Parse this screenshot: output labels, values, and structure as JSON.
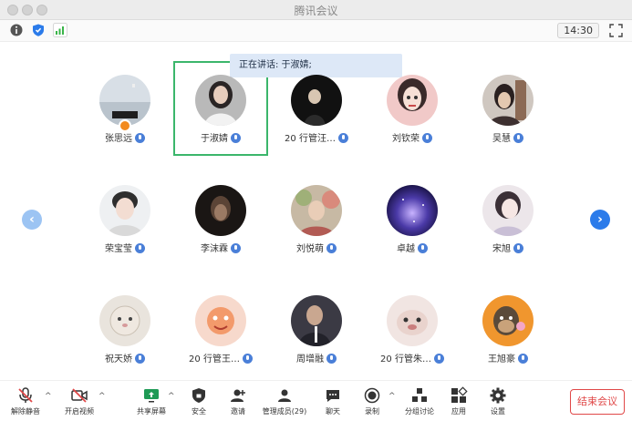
{
  "window": {
    "title": "腾讯会议"
  },
  "infobar": {
    "time": "14:30"
  },
  "speaking": {
    "text": "正在讲话: 于淑婧;"
  },
  "participants": [
    {
      "name": "张思远",
      "host": true
    },
    {
      "name": "于淑婧",
      "active": true
    },
    {
      "name": "20 行管汪…"
    },
    {
      "name": "刘钦荣"
    },
    {
      "name": "吴慧"
    },
    {
      "name": "荣宝莹"
    },
    {
      "name": "李沫霖"
    },
    {
      "name": "刘悦萌"
    },
    {
      "name": "卓越"
    },
    {
      "name": "宋旭"
    },
    {
      "name": "祝天娇"
    },
    {
      "name": "20 行管王…"
    },
    {
      "name": "周增融"
    },
    {
      "name": "20 行管朱…"
    },
    {
      "name": "王旭豪"
    }
  ],
  "toolbar": {
    "unmute": "解除静音",
    "start_video": "开启视频",
    "share_screen": "共享屏幕",
    "security": "安全",
    "invite": "邀请",
    "manage_members": "管理成员(29)",
    "chat": "聊天",
    "record": "录制",
    "breakout": "分组讨论",
    "apps": "应用",
    "settings": "设置",
    "end_meeting": "结束会议"
  },
  "colors": {
    "accent": "#2b7bea",
    "speaking_frame": "#3bb66b",
    "end": "#e04848",
    "share_icon": "#1e9a55"
  }
}
